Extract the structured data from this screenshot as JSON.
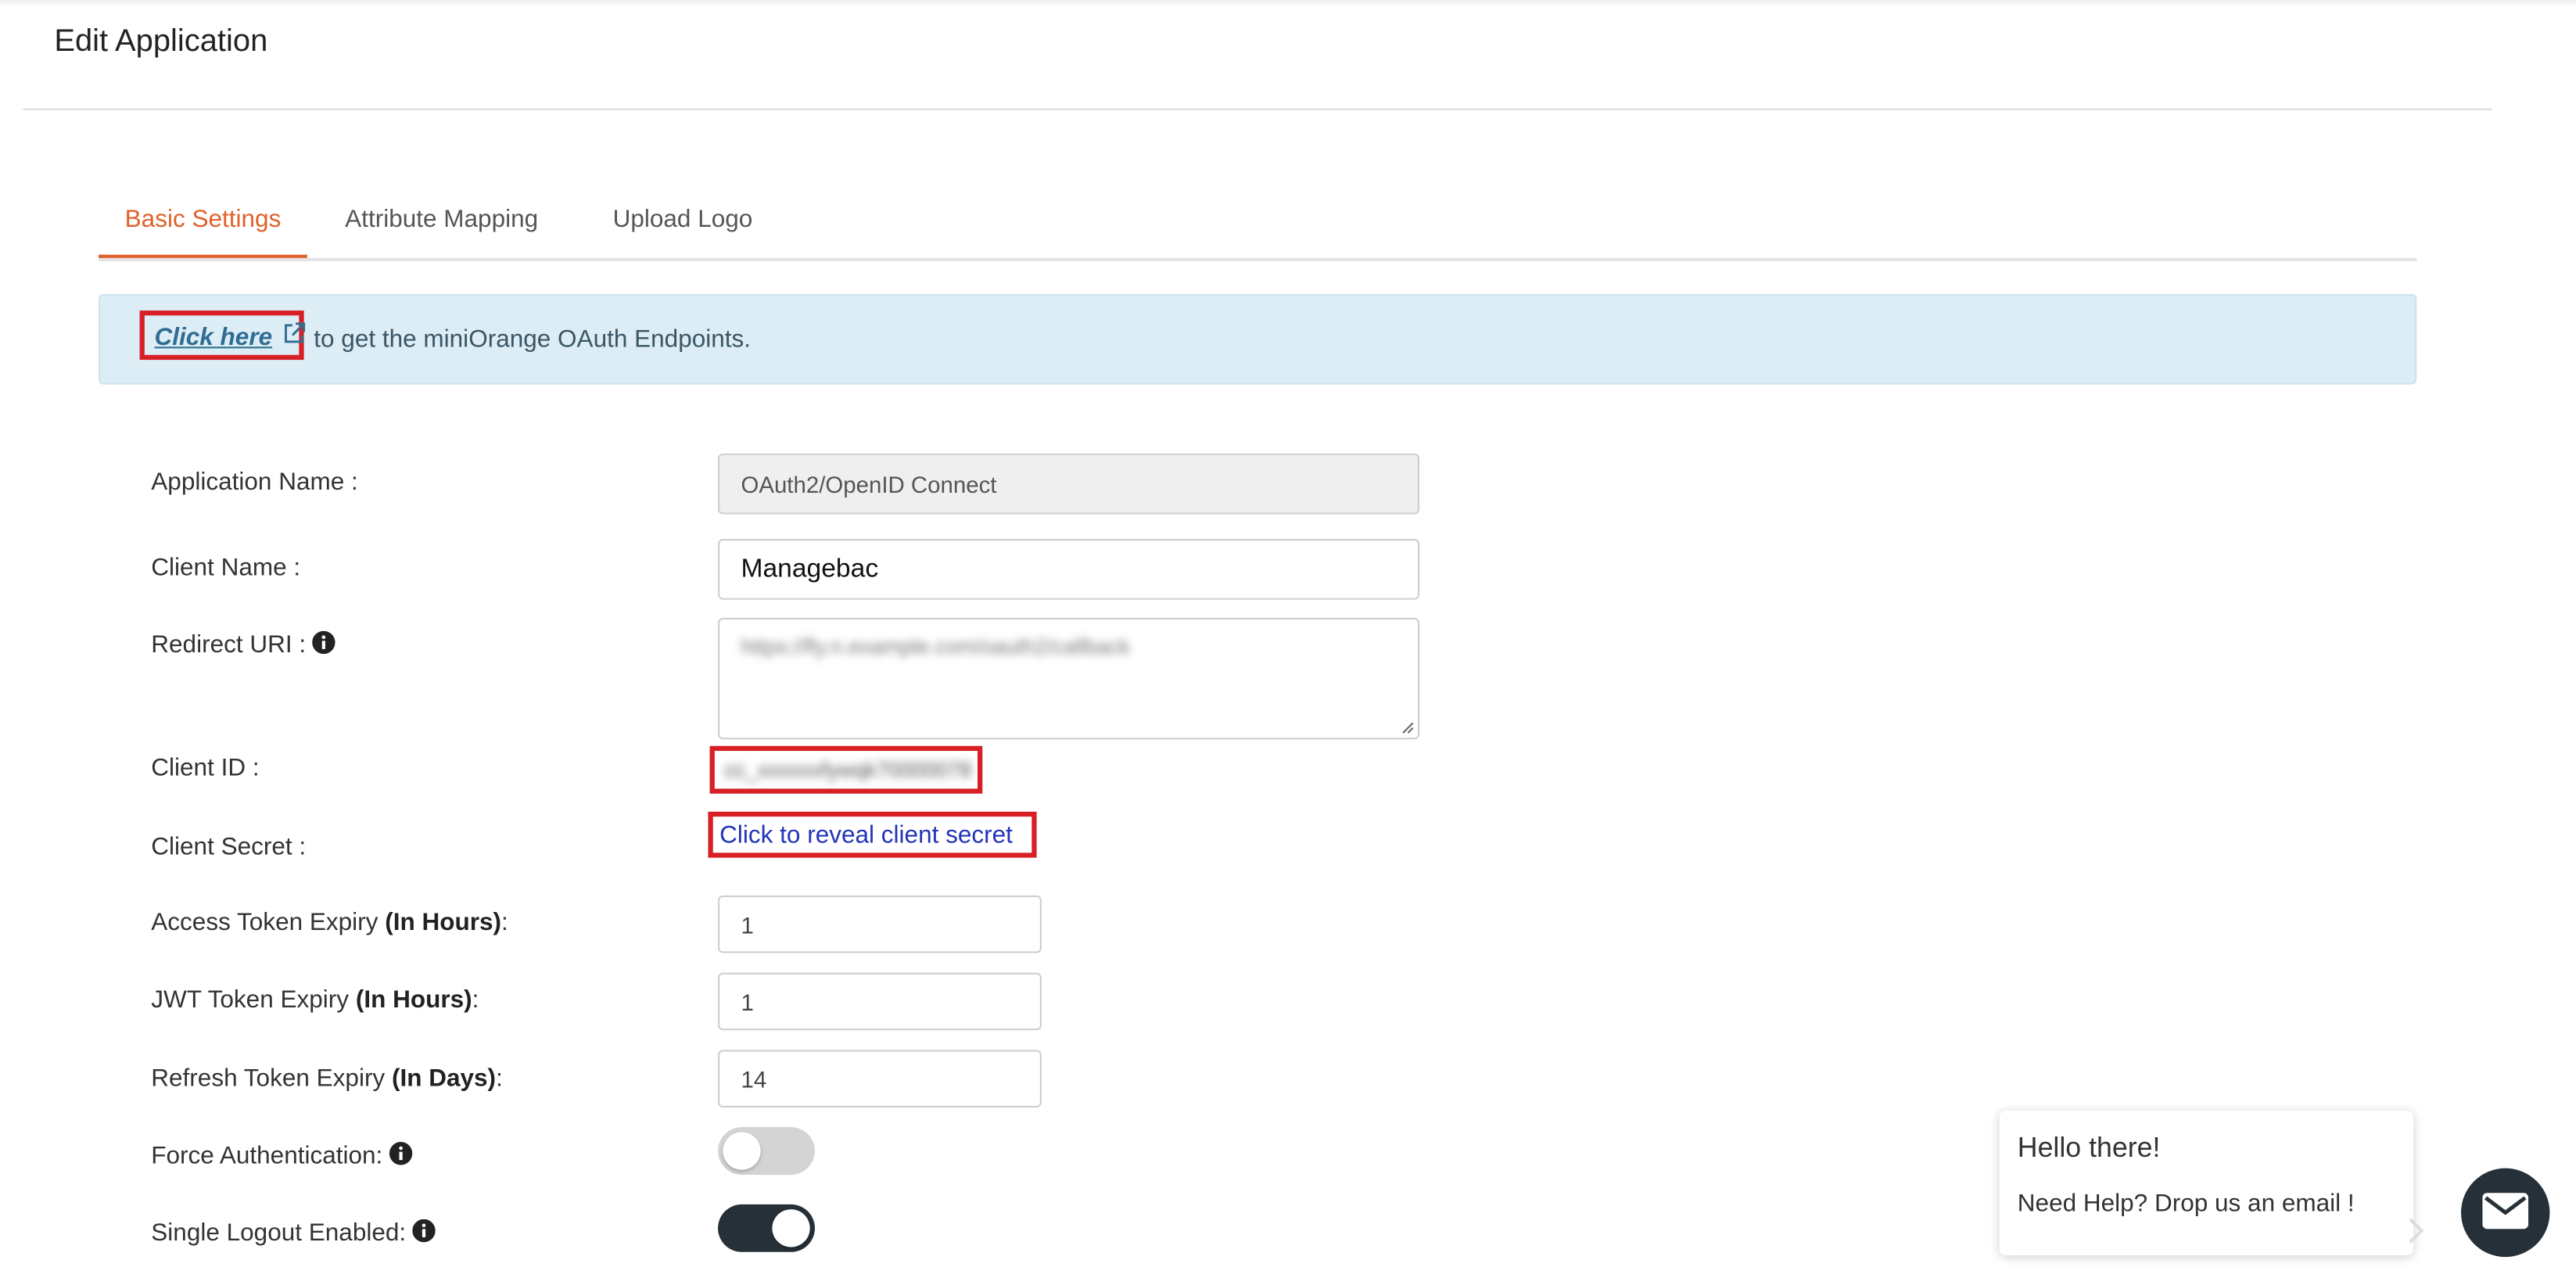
{
  "page": {
    "title": "Edit Application"
  },
  "tabs": [
    {
      "label": "Basic Settings",
      "active": true
    },
    {
      "label": "Attribute Mapping",
      "active": false
    },
    {
      "label": "Upload Logo",
      "active": false
    }
  ],
  "alert": {
    "link_label": "Click here",
    "text": "to get the miniOrange OAuth Endpoints.",
    "link_icon": "external-link-icon"
  },
  "form": {
    "application_name": {
      "label": "Application Name :",
      "value": "OAuth2/OpenID Connect"
    },
    "client_name": {
      "label": "Client Name :",
      "value": "Managebac"
    },
    "redirect_uri": {
      "label": "Redirect URI :",
      "value": "https://fly.n.example.com/oauth2/callback"
    },
    "client_id": {
      "label": "Client ID :",
      "value": "cc_xxxxxxfywqk70000078"
    },
    "client_secret": {
      "label": "Client Secret :",
      "link": "Click to reveal client secret"
    },
    "access_token_expiry": {
      "label_prefix": "Access Token Expiry",
      "label_bold": "(In Hours)",
      "label_suffix": ":",
      "value": "1"
    },
    "jwt_token_expiry": {
      "label_prefix": "JWT Token Expiry",
      "label_bold": "(In Hours)",
      "label_suffix": ":",
      "value": "1"
    },
    "refresh_token_expiry": {
      "label_prefix": "Refresh Token Expiry",
      "label_bold": "(In Days)",
      "label_suffix": ":",
      "value": "14"
    },
    "force_authentication": {
      "label": "Force Authentication:",
      "enabled": false
    },
    "single_logout": {
      "label": "Single Logout Enabled:",
      "enabled": true
    }
  },
  "chat": {
    "greeting": "Hello there!",
    "message": "Need Help? Drop us an email !",
    "button_icon": "mail-icon"
  },
  "colors": {
    "accent": "#e0602a",
    "alert_bg": "#dcedf6",
    "highlight_border": "#d81f26",
    "link": "#2233b8",
    "dark": "#253038"
  }
}
